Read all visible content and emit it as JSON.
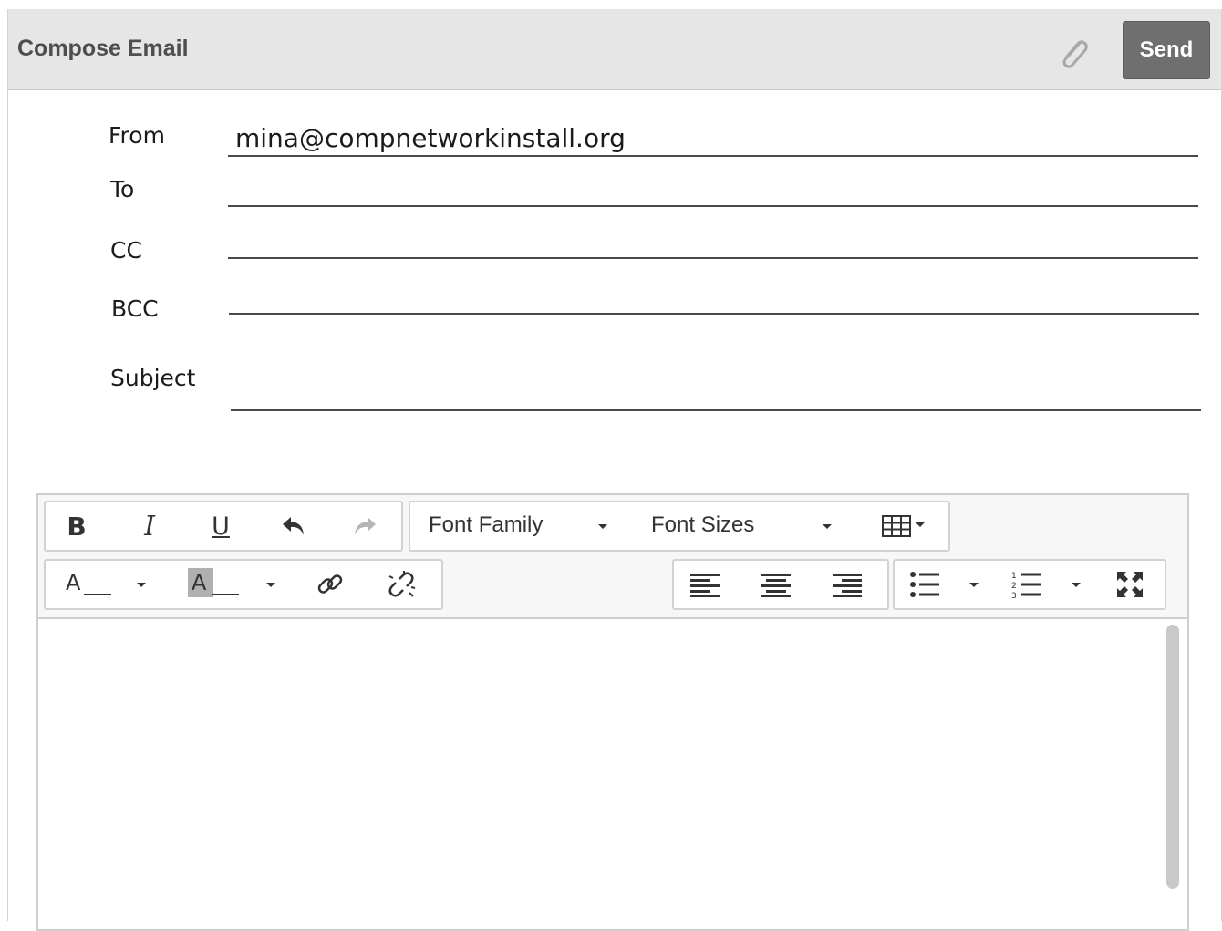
{
  "header": {
    "title": "Compose Email",
    "attach_icon": "paperclip-icon",
    "send_label": "Send"
  },
  "fields": {
    "from": {
      "label": "From",
      "value": "mina@compnetworkinstall.org"
    },
    "to": {
      "label": "To",
      "value": ""
    },
    "cc": {
      "label": "CC",
      "value": ""
    },
    "bcc": {
      "label": "BCC",
      "value": ""
    },
    "subject": {
      "label": "Subject",
      "value": ""
    }
  },
  "toolbar": {
    "bold_label": "B",
    "italic_label": "I",
    "underline_label": "U",
    "font_family": "Font Family",
    "font_sizes": "Font Sizes",
    "text_color_label": "A",
    "bg_color_label": "A",
    "icons": {
      "undo": "undo-icon",
      "redo": "redo-icon",
      "table": "table-icon",
      "link": "link-icon",
      "unlink": "unlink-icon",
      "align_left": "align-left-icon",
      "align_center": "align-center-icon",
      "align_right": "align-right-icon",
      "bullet_list": "bullet-list-icon",
      "numbered_list": "numbered-list-icon",
      "fullscreen": "fullscreen-icon"
    }
  },
  "colors": {
    "header_bg": "#e6e6e6",
    "send_bg": "#6f6f6f",
    "text": "#1b1b1b"
  }
}
